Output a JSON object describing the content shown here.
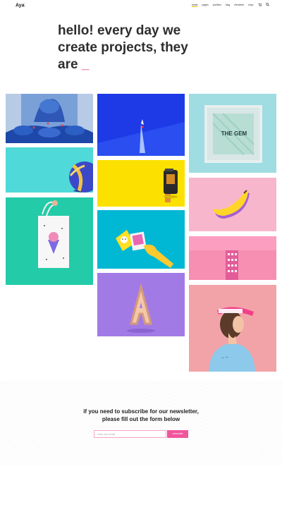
{
  "header": {
    "logo": "Aya",
    "logo_mark": "*",
    "nav": [
      "home",
      "pages",
      "portfolio",
      "blog",
      "elements",
      "shop"
    ],
    "cart_icon": "cart-icon",
    "search_icon": "search-icon"
  },
  "hero": {
    "line1": "hello! every day we",
    "line2": "create projects, they",
    "line3": "are",
    "cursor": "_"
  },
  "portfolio": {
    "tiles": [
      {
        "name": "tile-blue-chairs",
        "color": "#3d5fb8"
      },
      {
        "name": "tile-ball-cyan",
        "color": "#4fd9d9"
      },
      {
        "name": "tile-tote-bag",
        "color": "#23cba8"
      },
      {
        "name": "tile-paper-boat",
        "color": "#1d3ae6"
      },
      {
        "name": "tile-film-roll",
        "color": "#fce100"
      },
      {
        "name": "tile-hand-polaroid",
        "color": "#00b7d4"
      },
      {
        "name": "tile-letter-a",
        "color": "#a27ae6"
      },
      {
        "name": "tile-thegem-frame",
        "color": "#9fdde2"
      },
      {
        "name": "tile-banana",
        "color": "#f7b6cc"
      },
      {
        "name": "tile-pink-building",
        "color": "#f78fb3"
      },
      {
        "name": "tile-girl-visor",
        "color": "#f2a3a8"
      }
    ],
    "frame_text": "THE GEM"
  },
  "newsletter": {
    "line1": "if you need to subscribe for our newsletter,",
    "line2": "please fill out the form below",
    "placeholder": "enter your email",
    "button": "subscribe"
  },
  "colors": {
    "accent": "#f0559c",
    "nav_active": "#f2c200"
  }
}
